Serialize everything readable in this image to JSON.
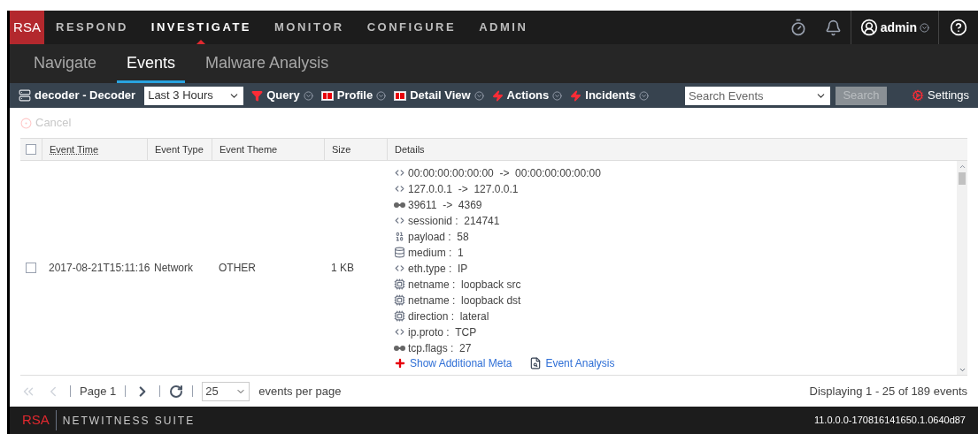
{
  "nav": {
    "logo": "RSA",
    "items": [
      {
        "label": "RESPOND",
        "selected": false
      },
      {
        "label": "INVESTIGATE",
        "selected": true
      },
      {
        "label": "MONITOR",
        "selected": false
      },
      {
        "label": "CONFIGURE",
        "selected": false
      },
      {
        "label": "ADMIN",
        "selected": false
      }
    ],
    "user": "admin"
  },
  "subtabs": [
    {
      "label": "Navigate",
      "selected": false
    },
    {
      "label": "Events",
      "selected": true
    },
    {
      "label": "Malware Analysis",
      "selected": false
    }
  ],
  "toolbar": {
    "service": "decoder - Decoder",
    "time_range": "Last 3 Hours",
    "menus": [
      {
        "label": "Query",
        "kind": "filter"
      },
      {
        "label": "Profile",
        "kind": "panel"
      },
      {
        "label": "Detail View",
        "kind": "panel"
      },
      {
        "label": "Actions",
        "kind": "bolt"
      },
      {
        "label": "Incidents",
        "kind": "bolt"
      }
    ],
    "search_placeholder": "Search Events",
    "search_button": "Search",
    "settings": "Settings"
  },
  "cancel": {
    "label": "Cancel",
    "disabled": true
  },
  "table": {
    "header_checked": false,
    "columns": [
      "Event Time",
      "Event Type",
      "Event Theme",
      "Size",
      "Details"
    ],
    "rows": [
      {
        "checked": false,
        "cells": [
          "2017-08-21T15:11:16",
          "Network",
          "OTHER",
          "1 KB"
        ],
        "details": [
          {
            "kind": "pair",
            "text": "00:00:00:00:00:00  ->  00:00:00:00:00:00"
          },
          {
            "kind": "pair",
            "text": "127.0.0.1  ->  127.0.0.1"
          },
          {
            "kind": "port",
            "text": "39611  ->  4369"
          },
          {
            "kind": "pair",
            "text": "sessionid :  214741"
          },
          {
            "kind": "binary",
            "text": "payload :  58"
          },
          {
            "kind": "db",
            "text": "medium :  1"
          },
          {
            "kind": "pair",
            "text": "eth.type :  IP"
          },
          {
            "kind": "chip",
            "text": "netname :  loopback src"
          },
          {
            "kind": "chip",
            "text": "netname :  loopback dst"
          },
          {
            "kind": "chip",
            "text": "direction :  lateral"
          },
          {
            "kind": "pair",
            "text": "ip.proto :  TCP"
          },
          {
            "kind": "port",
            "text": "tcp.flags :  27"
          }
        ],
        "links": [
          {
            "kind": "plus",
            "text": "Show Additional Meta"
          },
          {
            "kind": "analysis",
            "text": "Event Analysis"
          }
        ]
      }
    ]
  },
  "pager": {
    "page": "Page 1",
    "page_size": "25",
    "per_page": "events per page",
    "summary": "Displaying 1 - 25 of 189 events"
  },
  "footer": {
    "brand": "RSA",
    "product": "NETWITNESS SUITE",
    "version": "11.0.0.0-170816141650.1.0640d87"
  }
}
